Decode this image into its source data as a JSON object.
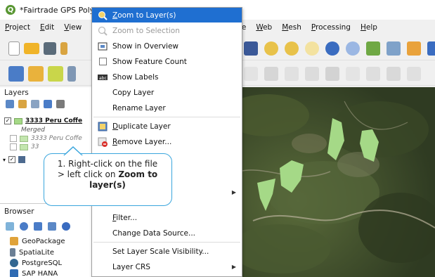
{
  "window": {
    "title": "*Fairtrade GPS Polygo"
  },
  "menubar": {
    "items": [
      "Project",
      "Edit",
      "View"
    ],
    "items_right": [
      "Database",
      "Web",
      "Mesh",
      "Processing",
      "Help"
    ]
  },
  "layers_panel": {
    "title": "Layers",
    "layers": [
      {
        "label": "3333 Peru Coffe",
        "checked": true
      },
      {
        "label": "Merged"
      },
      {
        "label": "3333 Peru Coffe"
      },
      {
        "label": "33"
      }
    ]
  },
  "browser_panel": {
    "title": "Browser",
    "items": [
      "GeoPackage",
      "SpatiaLite",
      "PostgreSQL",
      "SAP HANA"
    ]
  },
  "context_menu": {
    "items": [
      {
        "label": "Zoom to Layer(s)",
        "highlighted": true
      },
      {
        "label": "Zoom to Selection",
        "disabled": true
      },
      {
        "label": "Show in Overview"
      },
      {
        "label": "Show Feature Count"
      },
      {
        "label": "Show Labels"
      },
      {
        "label": "Copy Layer"
      },
      {
        "label": "Rename Layer"
      },
      {
        "label": "Duplicate Layer"
      },
      {
        "label": "Remove Layer..."
      },
      {
        "label": "Filter..."
      },
      {
        "label": "Change Data Source..."
      },
      {
        "label": "Set Layer Scale Visibility..."
      },
      {
        "label": "Layer CRS"
      }
    ]
  },
  "callout": {
    "line1": "1. Right-click on the file",
    "line2_prefix": "> left click on ",
    "line2_bold": "Zoom to",
    "line3_bold": "layer(s)"
  },
  "colors": {
    "accent": "#1f6fd1",
    "callout_border": "#3aa6dd",
    "polygon_fill": "#a5d987",
    "qgis_green": "#589632"
  }
}
